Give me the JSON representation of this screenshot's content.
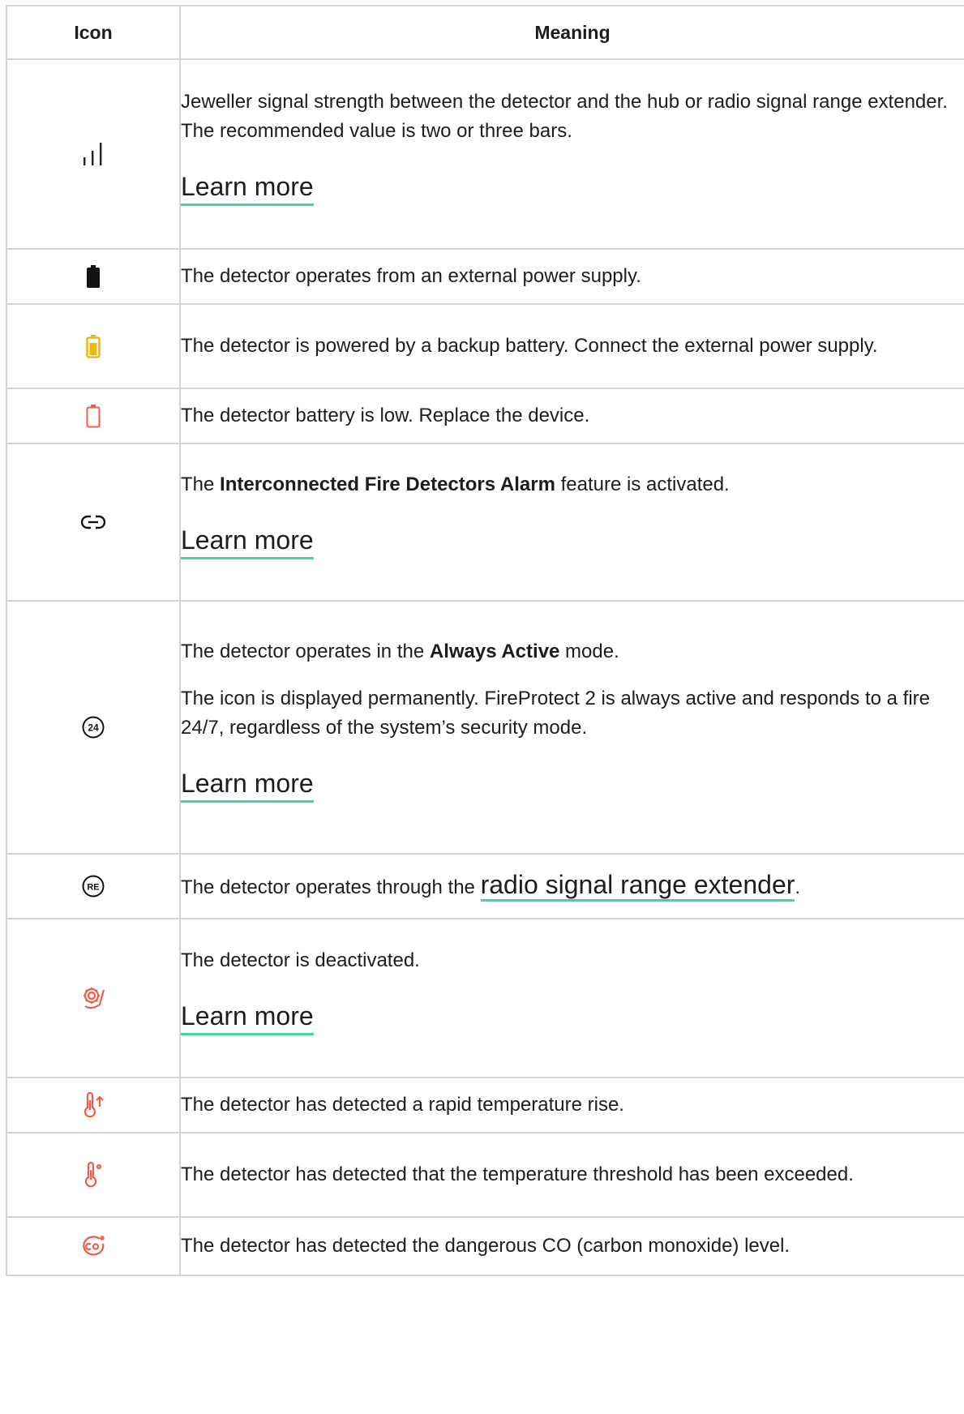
{
  "header": {
    "icon": "Icon",
    "meaning": "Meaning"
  },
  "colors": {
    "accent_underline": "#43d69b",
    "warning": "#f2b705",
    "alert": "#ef5c4a",
    "text": "#1d1d1f",
    "border": "#d3d3d3"
  },
  "rows": [
    {
      "icon": "signal-bars-icon",
      "text": "Jeweller signal strength between the detector and the hub or radio signal range extender. The recommended value is two or three bars.",
      "link": "Learn more"
    },
    {
      "icon": "battery-full-icon",
      "text": "The detector operates from an external power supply."
    },
    {
      "icon": "battery-backup-icon",
      "text": "The detector is powered by a backup battery. Connect the external power supply."
    },
    {
      "icon": "battery-low-icon",
      "text": "The detector battery is low. Replace the device."
    },
    {
      "icon": "link-icon",
      "pre": "The ",
      "bold": "Interconnected Fire Detectors Alarm",
      "post": " feature is activated.",
      "link": "Learn more"
    },
    {
      "icon": "always-active-24-icon",
      "pre": "The detector operates in the ",
      "bold": "Always Active",
      "post": " mode.",
      "text2": "The icon is displayed permanently. FireProtect 2 is always active and responds to a fire 24/7, regardless of the system’s security mode.",
      "link": "Learn more"
    },
    {
      "icon": "range-extender-re-icon",
      "pre": "The detector operates through the ",
      "inline_link": "radio signal range extender",
      "post": "."
    },
    {
      "icon": "deactivated-gear-icon",
      "text": "The detector is deactivated.",
      "link": "Learn more"
    },
    {
      "icon": "thermometer-rise-icon",
      "text": "The detector has detected a rapid temperature rise."
    },
    {
      "icon": "thermometer-threshold-icon",
      "text": "The detector has detected that the temperature threshold has been exceeded."
    },
    {
      "icon": "co-icon",
      "text": "The detector has detected the dangerous CO (carbon monoxide) level."
    }
  ]
}
